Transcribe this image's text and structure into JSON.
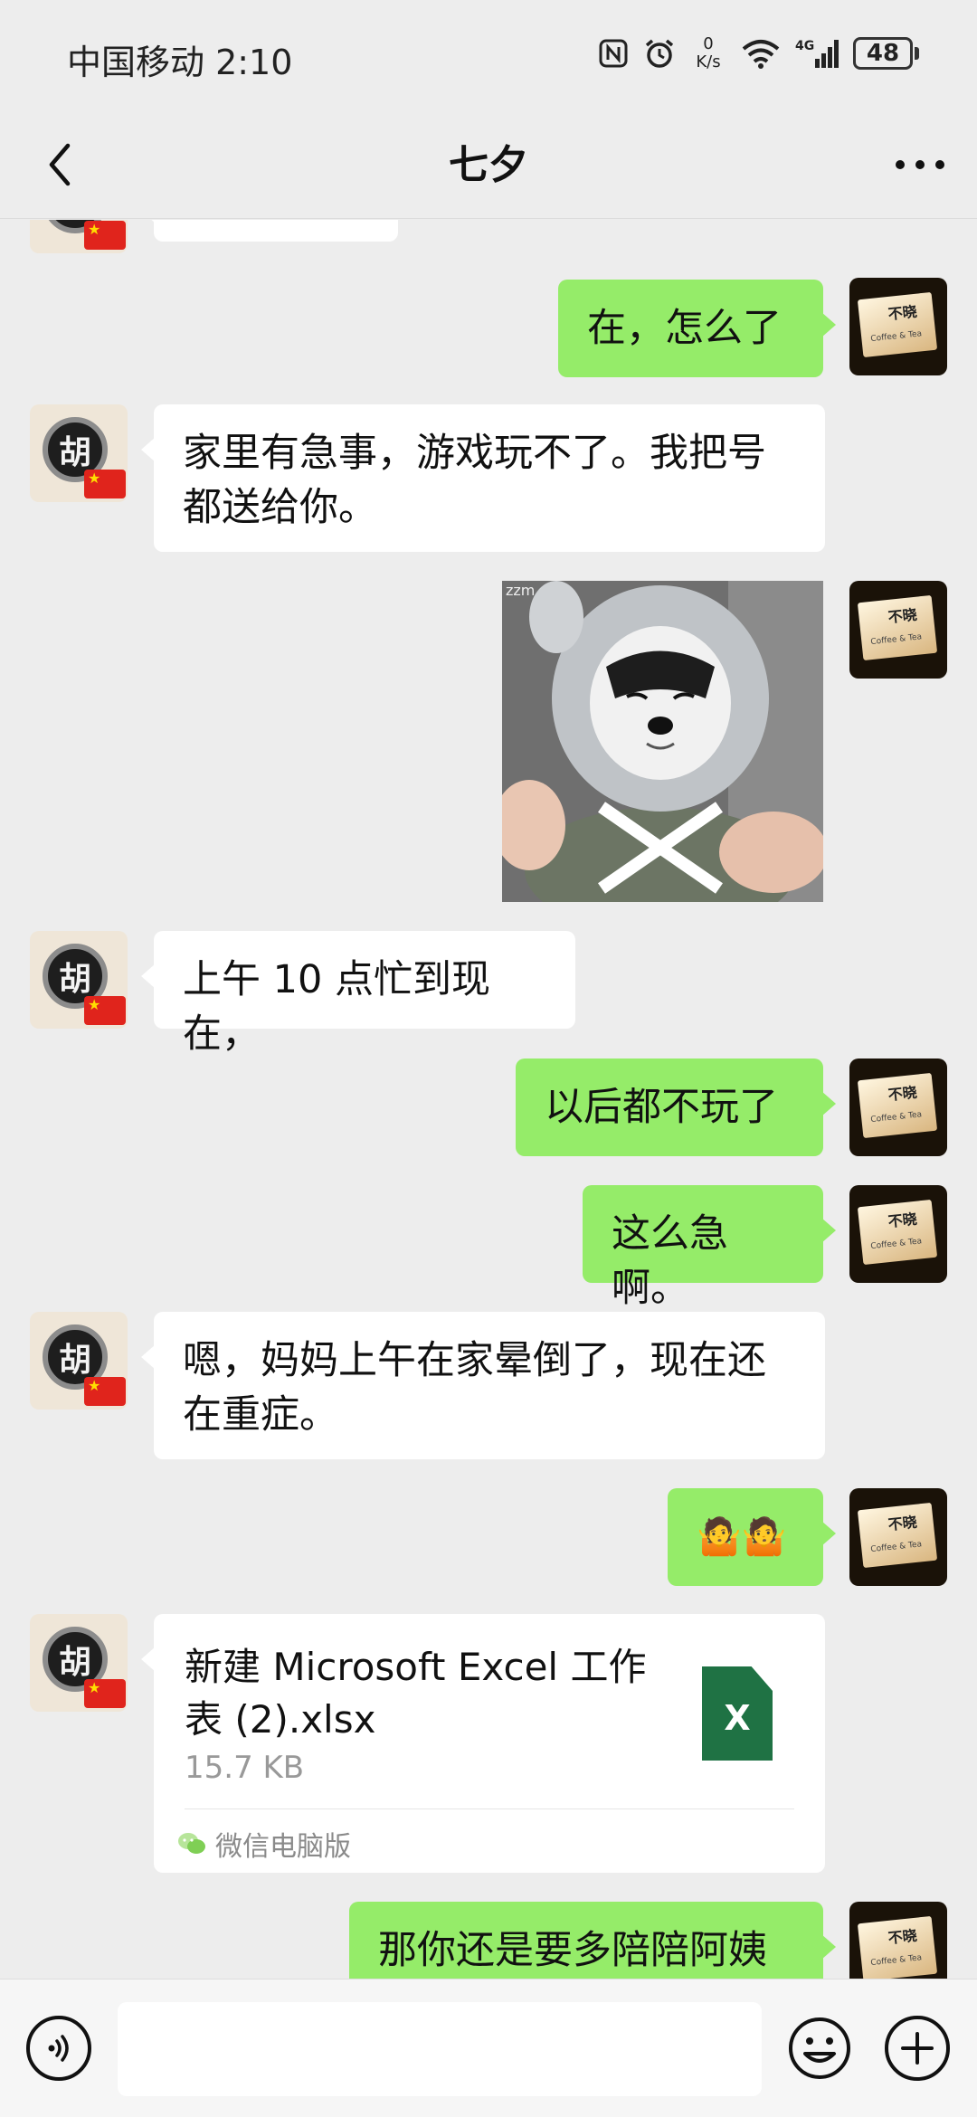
{
  "status_bar": {
    "carrier_time": "中国移动 2:10",
    "net_speed_value": "0",
    "net_speed_unit": "K/s",
    "network": "4G",
    "battery": "48"
  },
  "header": {
    "title": "七夕",
    "back_icon": "chevron-left-icon",
    "more_icon": "more-dots-icon"
  },
  "contact_avatar_char": "胡",
  "my_avatar_text": "不晓",
  "my_avatar_subtext": "Coffee & Tea",
  "sticker_caption": "zzm",
  "messages": [
    {
      "from": "me",
      "text": "在，怎么了"
    },
    {
      "from": "contact",
      "line1": "家里有急事，游戏玩不了。我把号",
      "line2": "都送给你。"
    },
    {
      "from": "me",
      "type": "sticker",
      "description_icon": "puppy-sticker"
    },
    {
      "from": "contact",
      "text": "上午 10 点忙到现在，"
    },
    {
      "from": "me",
      "text": "以后都不玩了"
    },
    {
      "from": "me",
      "text": "这么急啊。"
    },
    {
      "from": "contact",
      "line1": "嗯，妈妈上午在家晕倒了，现在还",
      "line2": "在重症。"
    },
    {
      "from": "me",
      "type": "emoji",
      "emoji": "🤷🤷"
    },
    {
      "from": "me",
      "text": "那你还是要多陪陪阿姨"
    }
  ],
  "file_message": {
    "name_line1": "新建 Microsoft Excel 工作",
    "name_line2": "表 (2).xlsx",
    "size": "15.7 KB",
    "icon_letter": "X",
    "source": "微信电脑版"
  },
  "input_bar": {
    "voice_icon": "voice-icon",
    "emoji_icon": "emoji-icon",
    "plus_icon": "plus-icon",
    "input_value": ""
  },
  "colors": {
    "background": "#ededed",
    "outgoing_bubble": "#95ec69",
    "incoming_bubble": "#ffffff",
    "excel_green": "#1f7244"
  }
}
